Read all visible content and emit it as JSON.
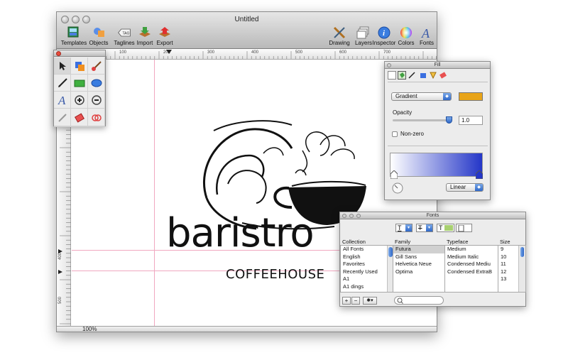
{
  "window": {
    "title": "Untitled",
    "zoom": "100%"
  },
  "toolbar": {
    "left": [
      {
        "label": "Templates",
        "icon": "templates-icon"
      },
      {
        "label": "Objects",
        "icon": "objects-icon"
      },
      {
        "label": "Taglines",
        "icon": "taglines-icon",
        "tag_text": "TAG"
      },
      {
        "label": "Import",
        "icon": "import-icon"
      },
      {
        "label": "Export",
        "icon": "export-icon"
      }
    ],
    "right": [
      {
        "label": "Drawing",
        "icon": "drawing-icon"
      },
      {
        "label": "Layers",
        "icon": "layers-icon"
      },
      {
        "label": "Inspector",
        "icon": "inspector-icon",
        "glyph": "i"
      },
      {
        "label": "Colors",
        "icon": "colors-icon"
      },
      {
        "label": "Fonts",
        "icon": "fonts-icon",
        "glyph": "A"
      }
    ]
  },
  "ruler": {
    "labels": [
      "100",
      "200",
      "300",
      "400",
      "500",
      "600",
      "700"
    ],
    "vlabels": [
      "400",
      "500"
    ]
  },
  "tools": {
    "icons": [
      "pointer-icon",
      "shapes-icon",
      "brush-icon",
      "pen-icon",
      "rectangle-icon",
      "ellipse-icon",
      "text-icon",
      "zoom-in-icon",
      "zoom-out-icon",
      "eyedropper-icon",
      "layers-stack-icon",
      "move-icon",
      "pencil-icon",
      "eraser-icon",
      "rings-icon"
    ],
    "text_glyph": "A"
  },
  "logo": {
    "word": "baristro",
    "tagline": "COFFEEHOUSE"
  },
  "fill_panel": {
    "title": "Fill",
    "fill_type": "Gradient",
    "swatch_color": "#e8a418",
    "opacity_label": "Opacity",
    "opacity_value": "1.0",
    "nonzero_label": "Non-zero",
    "gradient_start": "#ffffff",
    "gradient_end": "#2436c8",
    "gradient_type": "Linear"
  },
  "fonts_panel": {
    "title": "Fonts",
    "headers": {
      "collection": "Collection",
      "family": "Family",
      "typeface": "Typeface",
      "size": "Size"
    },
    "collections": [
      "All Fonts",
      "English",
      "Favorites",
      "Recently Used",
      "A1",
      "A1 dings"
    ],
    "families": [
      "Futura",
      "Gill Sans",
      "Helvetica Neue",
      "Optima"
    ],
    "typefaces": [
      "Medium",
      "Medium Italic",
      "Condensed Mediu",
      "Condensed ExtraB"
    ],
    "sizes": [
      "9",
      "10",
      "11",
      "12",
      "13"
    ],
    "add_label": "+",
    "remove_label": "−",
    "action_label": "✱▾",
    "color_swatch": "#a8d070"
  }
}
